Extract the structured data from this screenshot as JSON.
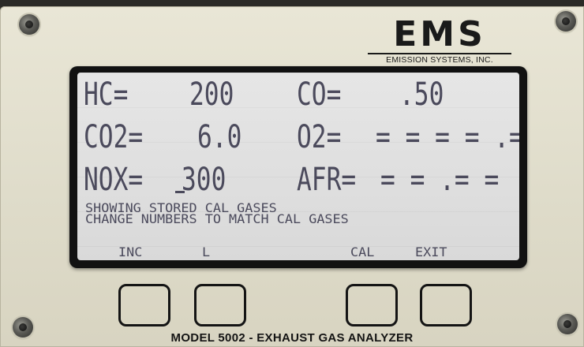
{
  "brand": {
    "logo_text": "EMS",
    "company_name": "EMISSION SYSTEMS, INC."
  },
  "display": {
    "readings": [
      {
        "label": "HC=",
        "value": "200"
      },
      {
        "label": "CO=",
        "value": ".50"
      },
      {
        "label": "CO2=",
        "value": "6.0"
      },
      {
        "label": "O2=",
        "value": "= = = = .="
      },
      {
        "label": "NOX=",
        "value": "300"
      },
      {
        "label": "AFR=",
        "value": "= = .= ="
      }
    ],
    "messages": [
      "SHOWING STORED CAL GASES",
      "CHANGE NUMBERS TO MATCH CAL GASES"
    ],
    "softkeys": [
      "INC",
      "L",
      "CAL",
      "EXIT"
    ]
  },
  "footer": {
    "model_label": "MODEL 5002 - EXHAUST GAS ANALYZER"
  }
}
